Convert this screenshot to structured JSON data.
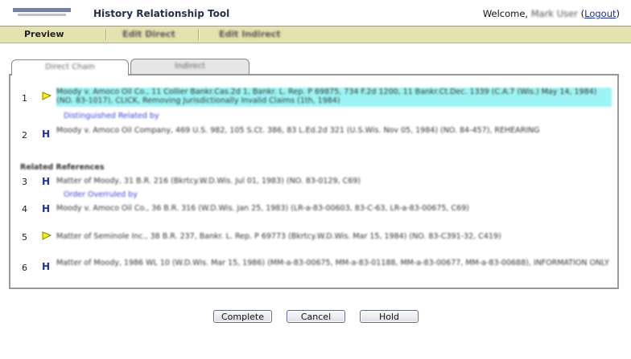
{
  "header": {
    "title": "History Relationship Tool",
    "welcome_label": "Welcome,",
    "user_name": "Mark User",
    "logout_label": "Logout"
  },
  "menu": [
    {
      "label": "Preview"
    },
    {
      "label": "Edit Direct"
    },
    {
      "label": "Edit Indirect"
    }
  ],
  "tabs": [
    {
      "label": "Direct Chain",
      "active": true
    },
    {
      "label": "Indirect",
      "active": false
    }
  ],
  "entries": [
    {
      "number": "1",
      "flag": "yellow-flag",
      "text": "Moody v. Amoco Oil Co., 11 Collier Bankr.Cas.2d 1, Bankr. L. Rep. P 69875, 734 F.2d 1200, 11 Bankr.Ct.Dec. 1339 (C.A.7 (Wis.) May 14, 1984) (NO. 83-1017), CLICK, Removing Jurisdictionally Invalid Claims (1th, 1984)",
      "highlighted": true,
      "sub_link": "Distinguished Related by"
    },
    {
      "number": "2",
      "flag": "H",
      "text": "Moody v. Amoco Oil Company, 469 U.S. 982, 105 S.Ct. 386, 83 L.Ed.2d 321 (U.S.Wis. Nov 05, 1984) (NO. 84-457), REHEARING",
      "highlighted": false,
      "sub_link": ""
    }
  ],
  "related_label": "Related References",
  "related": [
    {
      "number": "3",
      "flag": "H",
      "text": "Matter of Moody, 31 B.R. 216 (Bkrtcy.W.D.Wis. Jul 01, 1983) (NO. 83-0129, C69)",
      "sub_link": "Order Overruled by"
    },
    {
      "number": "4",
      "flag": "H",
      "text": "Moody v. Amoco Oil Co., 36 B.R. 316 (W.D.Wis. Jan 25, 1983) (LR-a-83-00603, 83-C-63, LR-a-83-00675, C69)",
      "sub_link": ""
    },
    {
      "number": "5",
      "flag": "yellow-flag",
      "text": "Matter of Seminole Inc., 38 B.R. 237, Bankr. L. Rep. P 69773 (Bkrtcy.W.D.Wis. Mar 15, 1984) (NO. 83-C391-32, C419)",
      "sub_link": ""
    },
    {
      "number": "6",
      "flag": "H",
      "text": "Matter of Moody, 1986 WL 10 (W.D.Wis. Mar 15, 1986) (MM-a-83-00675, MM-a-83-01188, MM-a-83-00677, MM-a-83-00688), INFORMATION ONLY",
      "sub_link": ""
    }
  ],
  "buttons": {
    "complete": "Complete",
    "cancel": "Cancel",
    "hold": "Hold"
  },
  "colors": {
    "menubar": "#e6e2b0",
    "highlight": "#9cf4f4",
    "link": "#1a2fa8",
    "h_icon": "#1a2fb0",
    "flag": "#f6f200"
  }
}
